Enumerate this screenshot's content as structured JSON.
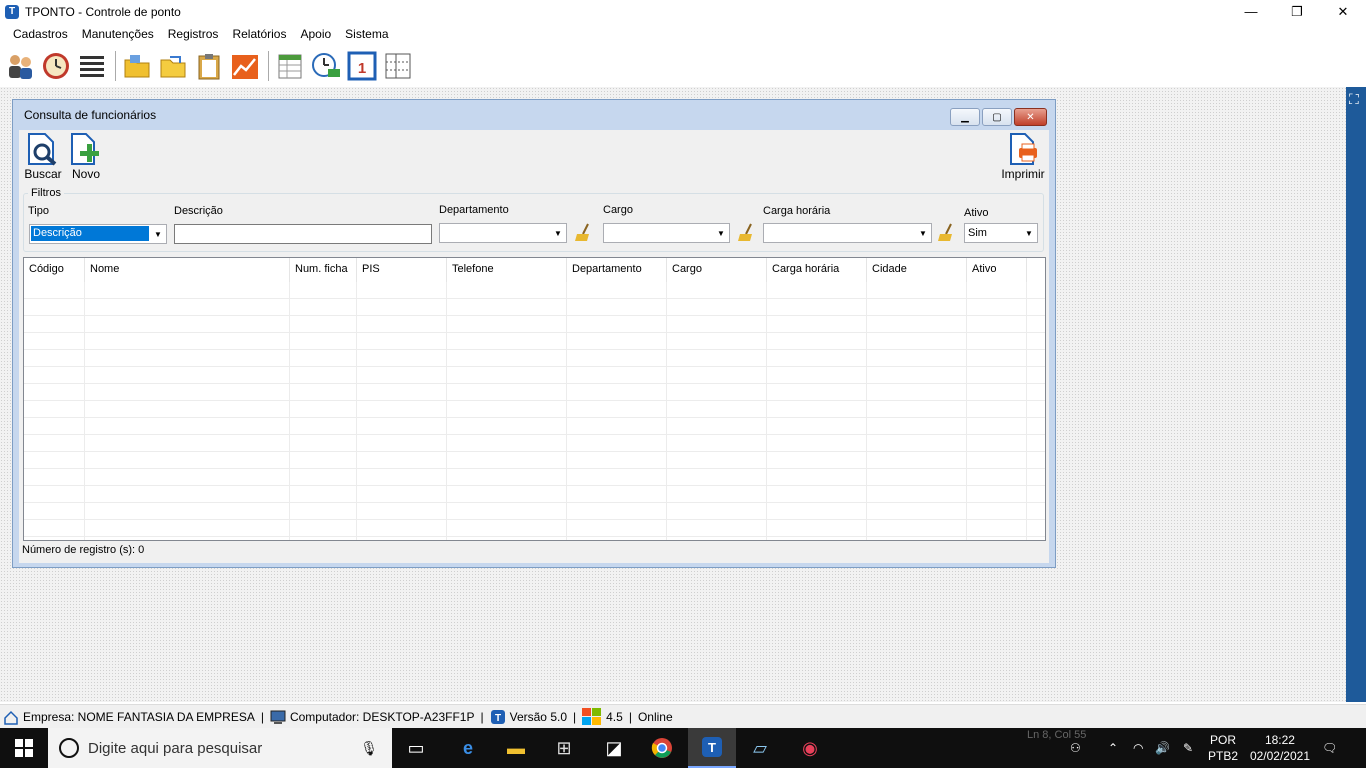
{
  "window": {
    "title": "TPONTO - Controle de ponto",
    "minimize": "—",
    "maximize": "❐",
    "close": "✕"
  },
  "menu": [
    "Cadastros",
    "Manutenções",
    "Registros",
    "Relatórios",
    "Apoio",
    "Sistema"
  ],
  "toolbar_icons": [
    "employees-icon",
    "clock-icon",
    "list-icon",
    "folder-icon",
    "folder-open-icon",
    "clipboard-icon",
    "chart-icon",
    "spreadsheet-icon",
    "time-sync-icon",
    "calendar-icon",
    "table-adjust-icon"
  ],
  "child": {
    "title": "Consulta de funcionários",
    "buttons": {
      "search": "Buscar",
      "new": "Novo",
      "print": "Imprimir"
    },
    "filters": {
      "legend": "Filtros",
      "tipo_label": "Tipo",
      "tipo_value": "Descrição",
      "descricao_label": "Descrição",
      "descricao_value": "",
      "departamento_label": "Departamento",
      "departamento_value": "",
      "cargo_label": "Cargo",
      "cargo_value": "",
      "carga_label": "Carga horária",
      "carga_value": "",
      "ativo_label": "Ativo",
      "ativo_value": "Sim"
    },
    "grid": {
      "columns": [
        "Código",
        "Nome",
        "Num. ficha",
        "PIS",
        "Telefone",
        "Departamento",
        "Cargo",
        "Carga horária",
        "Cidade",
        "Ativo"
      ],
      "rows": []
    },
    "record_count": "Número de registro (s): 0"
  },
  "statusbar": {
    "company": "Empresa: NOME FANTASIA DA EMPRESA",
    "computer": "Computador: DESKTOP-A23FF1P",
    "version": "Versão 5.0",
    "build": "4.5",
    "connection": "Online"
  },
  "taskbar": {
    "search_placeholder": "Digite aqui para pesquisar",
    "ghost_text": "Ln 8, Col 55",
    "lang_top": "POR",
    "lang_bottom": "PTB2",
    "time": "18:22",
    "date": "02/02/2021"
  },
  "colors": {
    "child_frame": "#c6d7ee",
    "selection": "#0078d7",
    "side_strip": "#1e5a9a",
    "taskbar": "#0f0f0f"
  }
}
